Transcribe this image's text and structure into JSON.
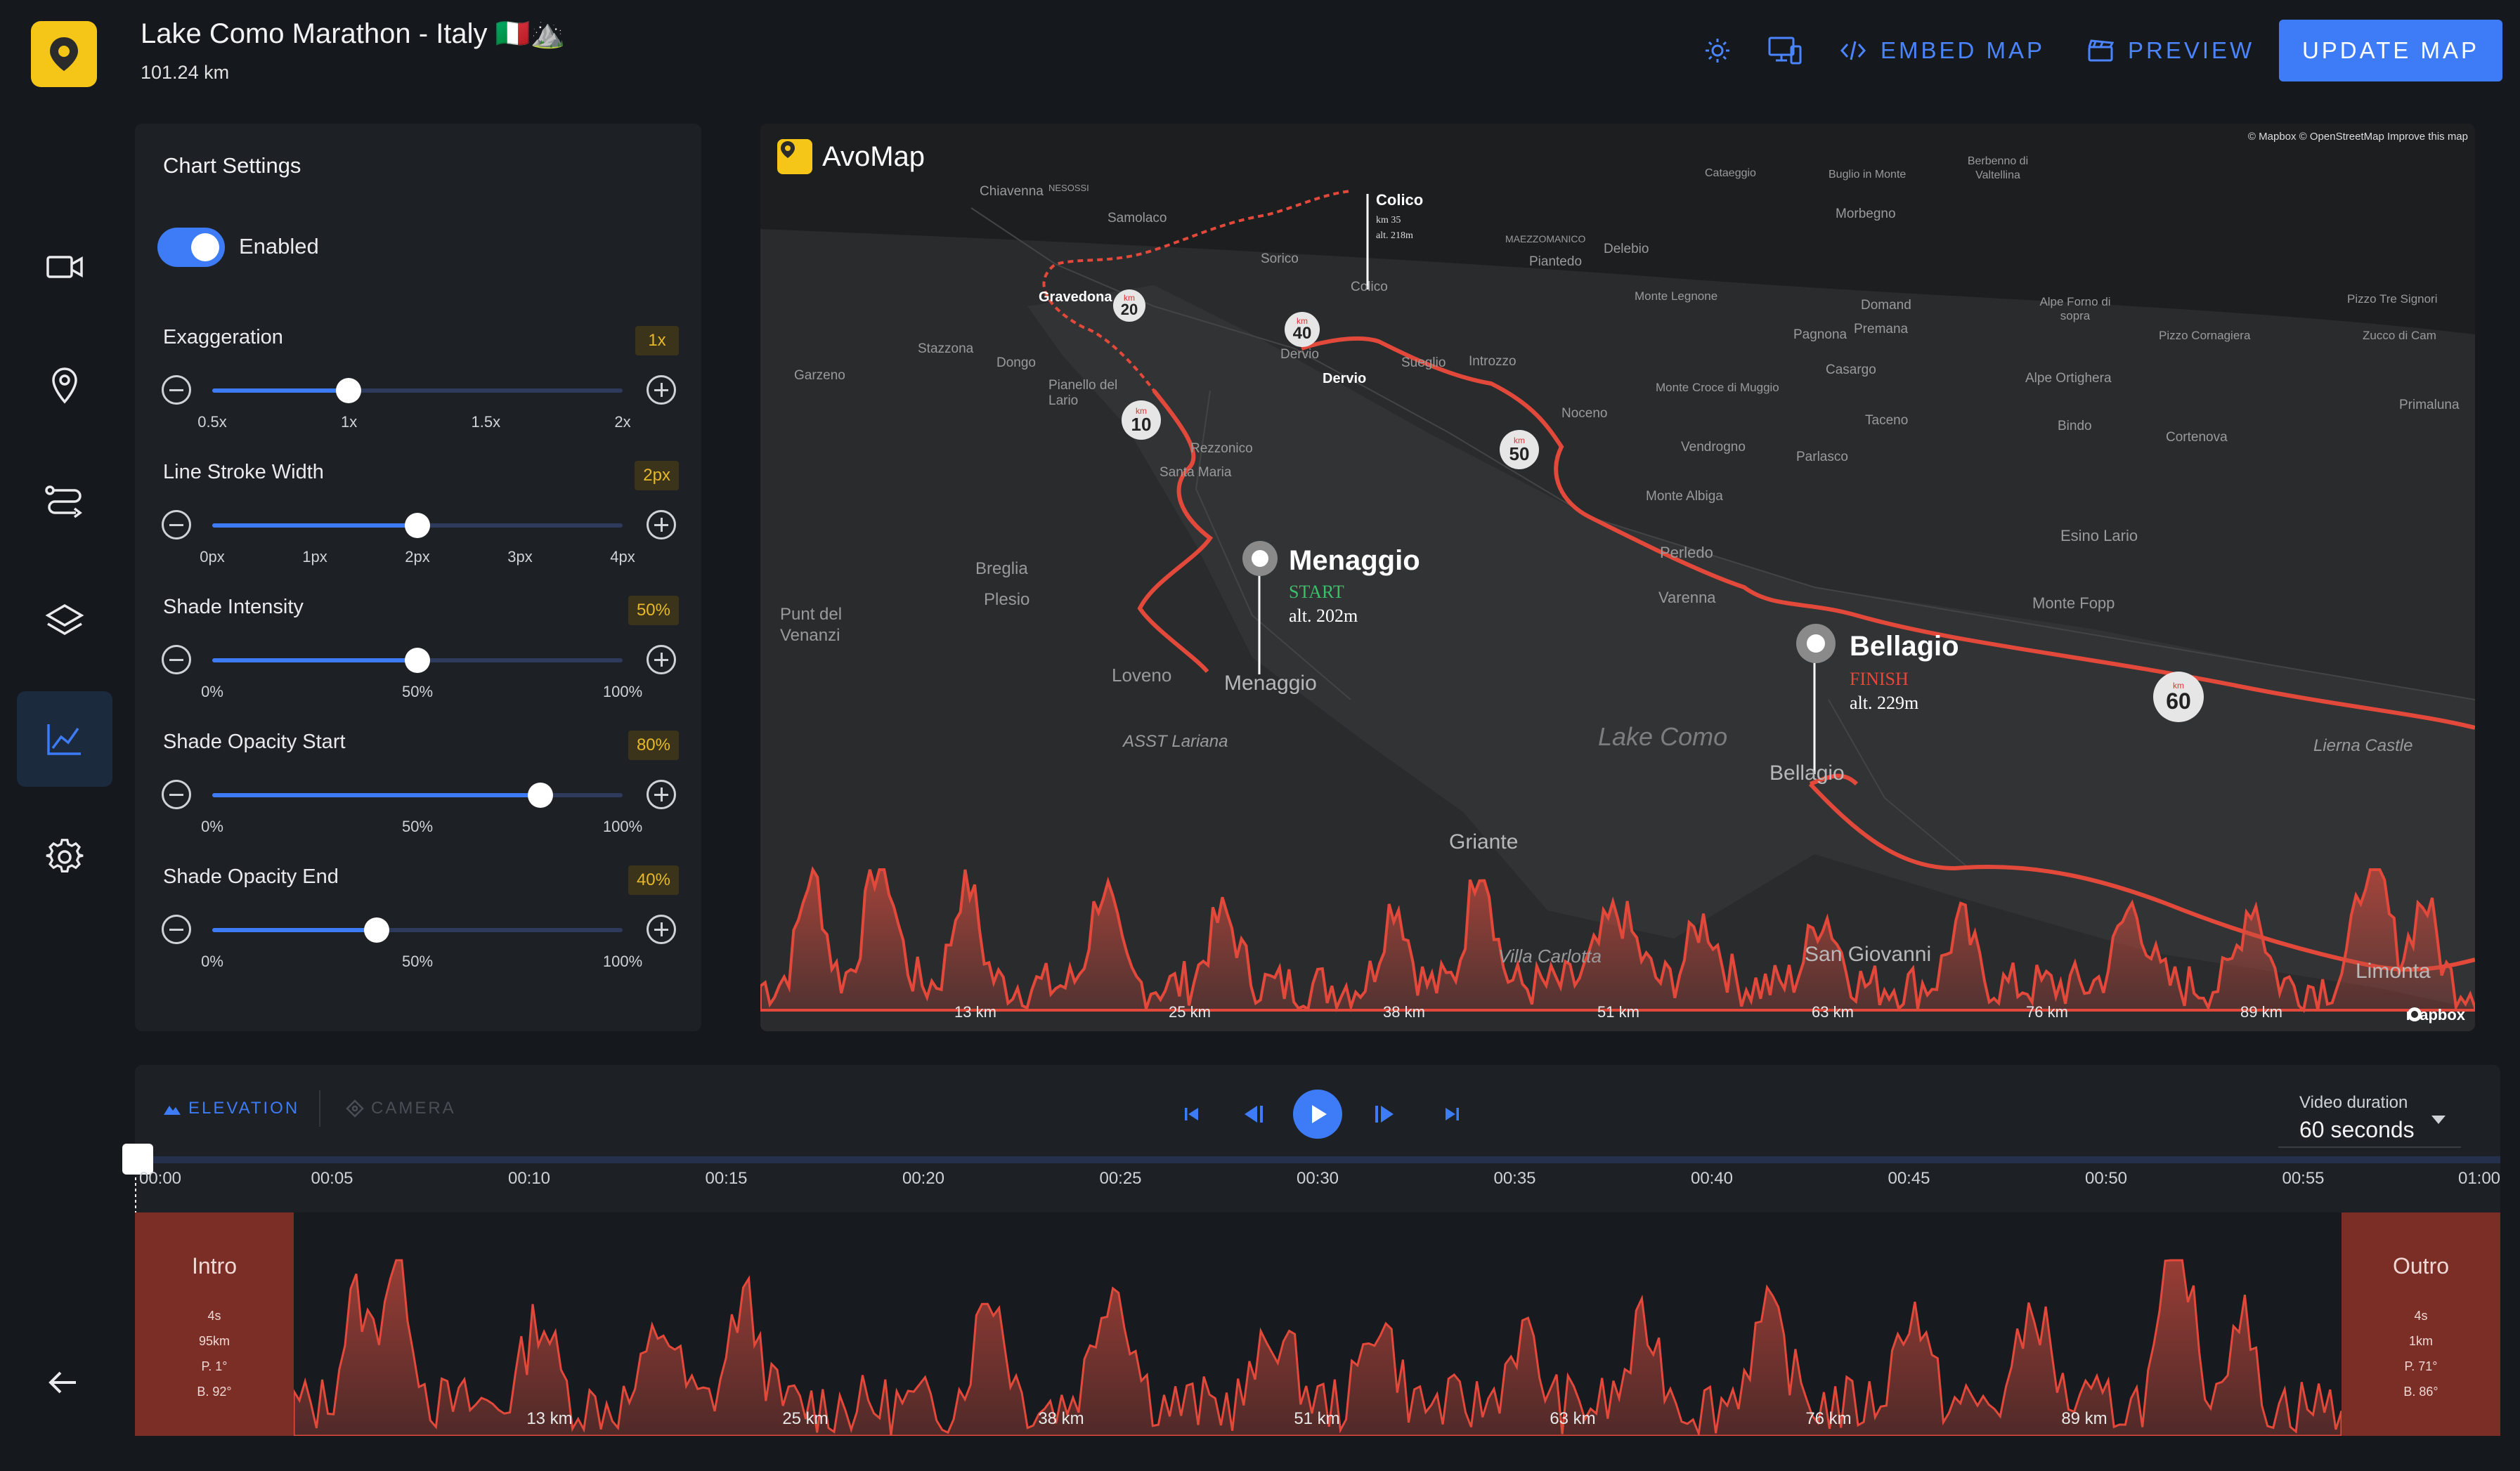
{
  "header": {
    "title": "Lake Como Marathon - Italy 🇮🇹⛰️",
    "distance": "101.24 km",
    "embed_label": "EMBED MAP",
    "preview_label": "PREVIEW",
    "update_label": "UPDATE MAP",
    "icons": [
      "avomap-logo-icon",
      "sun-icon",
      "devices-icon",
      "code-icon",
      "clapperboard-icon"
    ]
  },
  "sidebar": {
    "items": [
      {
        "name": "video",
        "icon": "video-camera-icon"
      },
      {
        "name": "location",
        "icon": "map-pin-icon"
      },
      {
        "name": "route",
        "icon": "route-icon"
      },
      {
        "name": "layers",
        "icon": "layers-icon"
      },
      {
        "name": "chart",
        "icon": "line-chart-icon",
        "active": true
      },
      {
        "name": "settings",
        "icon": "gear-icon"
      }
    ],
    "back_icon": "arrow-left-icon"
  },
  "chart_settings": {
    "title": "Chart Settings",
    "enabled_label": "Enabled",
    "enabled": true,
    "settings": [
      {
        "label": "Exaggeration",
        "value": "1x",
        "level": 0.333,
        "ticks": [
          "0.5x",
          "1x",
          "1.5x",
          "2x"
        ]
      },
      {
        "label": "Line Stroke Width",
        "value": "2px",
        "level": 0.5,
        "ticks": [
          "0px",
          "1px",
          "2px",
          "3px",
          "4px"
        ]
      },
      {
        "label": "Shade Intensity",
        "value": "50%",
        "level": 0.5,
        "ticks": [
          "0%",
          "50%",
          "100%"
        ]
      },
      {
        "label": "Shade Opacity Start",
        "value": "80%",
        "level": 0.8,
        "ticks": [
          "0%",
          "50%",
          "100%"
        ]
      },
      {
        "label": "Shade Opacity End",
        "value": "40%",
        "level": 0.4,
        "ticks": [
          "0%",
          "50%",
          "100%"
        ]
      }
    ]
  },
  "map": {
    "brand": "AvoMap",
    "attribution": "© Mapbox © OpenStreetMap  Improve this map",
    "mapbox": "mapbox",
    "places": {
      "chiavenna": "Chiavenna",
      "nesossi": "NESOSSI",
      "samolaco": "Samolaco",
      "sorico": "Sorico",
      "colico": "Colico",
      "gravedona": "Gravedona",
      "stazzona": "Stazzona",
      "dongo": "Dongo",
      "garzeno": "Garzeno",
      "pianello": "Pianello del Lario",
      "rezzonico": "Rezzonico",
      "santa_maria": "Santa Maria",
      "dervio": "Dervio",
      "sueglio": "Sueglio",
      "introzzo": "Introzzo",
      "noceno": "Noceno",
      "vendrogno": "Vendrogno",
      "monte_albiga": "Monte Albiga",
      "perledo": "Perledo",
      "varenna": "Varenna",
      "breglia": "Breglia",
      "plesio": "Plesio",
      "punt_del_venanzi": "Punt del Venanzi",
      "loveno": "Loveno",
      "menaggio_town": "Menaggio",
      "asst": "ASST Lariana",
      "lake_como": "Lake Como",
      "griante": "Griante",
      "villa_carlotta": "Villa Carlotta",
      "san_giovanni": "San Giovanni",
      "bellagio_town": "Bellagio",
      "limonta": "Limonta",
      "lierna": "Lierna Castle",
      "cataeggio": "Cataeggio",
      "buglio": "Buglio in Monte",
      "berbenno": "Berbenno di Valtellina",
      "morbegno": "Morbegno",
      "mezzomanico": "MAEZZOMANICO",
      "delebio": "Delebio",
      "piantedo": "Piantedo",
      "monte_legnone": "Monte Legnone",
      "domand": "Domand",
      "pagnona": "Pagnona",
      "premana": "Premana",
      "alpe_forno": "Alpe Forno di sopra",
      "pizzo_cornagiera": "Pizzo Cornagiera",
      "pizzo_tre_signori": "Pizzo Tre Signori",
      "zucco_di_cam": "Zucco di Cam",
      "monte_croce": "Monte Croce di Muggio",
      "casargo": "Casargo",
      "alpe_ortighera": "Alpe Ortighera",
      "primaluna": "Primaluna",
      "taceno": "Taceno",
      "bindo": "Bindo",
      "cortenova": "Cortenova",
      "parlasco": "Parlasco",
      "esino": "Esino Lario",
      "monte_fopp": "Monte Fopp"
    },
    "colico_km": "km 35",
    "colico_alt": "alt. 218m",
    "km_unit": "km",
    "km_markers": [
      "10",
      "20",
      "40",
      "50",
      "60"
    ],
    "start": {
      "title": "Menaggio",
      "tag": "START",
      "alt": "alt. 202m"
    },
    "finish": {
      "title": "Bellagio",
      "tag": "FINISH",
      "alt": "alt. 229m"
    },
    "elevation_ticks": [
      "13 km",
      "25 km",
      "38 km",
      "51 km",
      "63 km",
      "76 km",
      "89 km"
    ]
  },
  "timeline": {
    "tabs": [
      {
        "label": "ELEVATION",
        "active": true
      },
      {
        "label": "CAMERA",
        "active": false
      }
    ],
    "video_duration_label": "Video duration",
    "video_duration_value": "60 seconds",
    "times": [
      "00:00",
      "00:05",
      "00:10",
      "00:15",
      "00:20",
      "00:25",
      "00:30",
      "00:35",
      "00:40",
      "00:45",
      "00:50",
      "00:55",
      "01:00"
    ],
    "progress": 0,
    "intro": {
      "title": "Intro",
      "details": [
        "4s",
        "95km",
        "P. 1°",
        "B. 92°"
      ]
    },
    "outro": {
      "title": "Outro",
      "details": [
        "4s",
        "1km",
        "P. 71°",
        "B. 86°"
      ]
    },
    "km_ticks": [
      "13 km",
      "25 km",
      "38 km",
      "51 km",
      "63 km",
      "76 km",
      "89 km"
    ]
  }
}
